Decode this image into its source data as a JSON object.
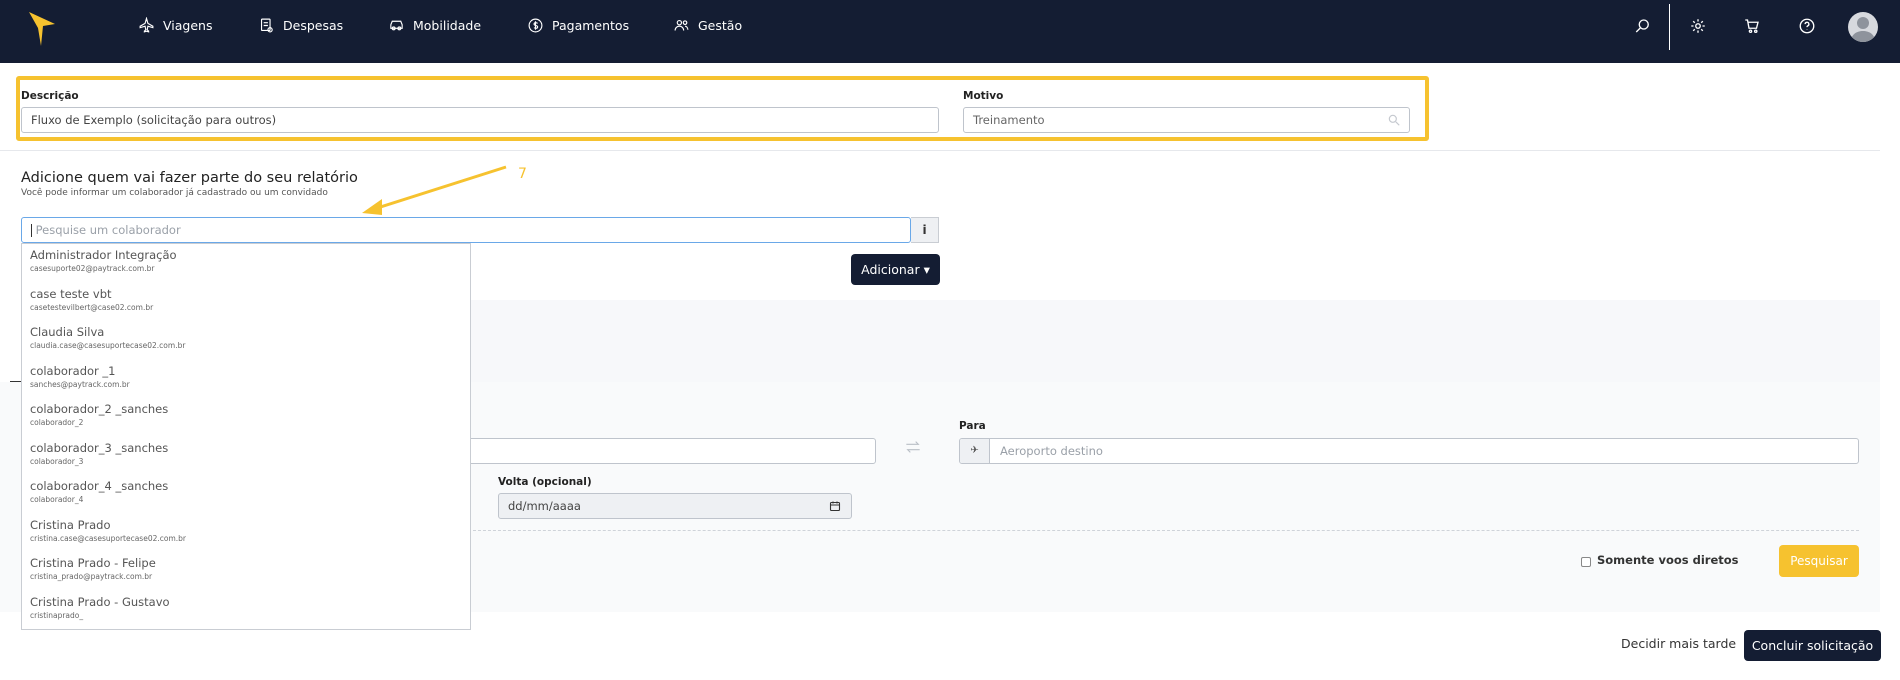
{
  "nav": {
    "items": [
      {
        "label": "Viagens",
        "icon": "plane-icon"
      },
      {
        "label": "Despesas",
        "icon": "receipt-icon"
      },
      {
        "label": "Mobilidade",
        "icon": "car-icon"
      },
      {
        "label": "Pagamentos",
        "icon": "dollar-circle-icon"
      },
      {
        "label": "Gestão",
        "icon": "users-icon"
      }
    ]
  },
  "form": {
    "descricao_label": "Descrição",
    "descricao_value": "Fluxo de Exemplo (solicitação para outros)",
    "motivo_label": "Motivo",
    "motivo_value": "Treinamento"
  },
  "participants": {
    "title": "Adicione quem vai fazer parte do seu relatório",
    "subtitle": "Você pode informar um colaborador já cadastrado ou um convidado",
    "search_placeholder": "Pesquise um colaborador",
    "info_label": "i",
    "add_button": "Adicionar ▾"
  },
  "annotation": {
    "number": "7",
    "color": "#f6c22f"
  },
  "dropdown": {
    "items": [
      {
        "name": "Administrador Integração",
        "email": "casesuporte02@paytrack.com.br"
      },
      {
        "name": "case teste vbt",
        "email": "casetestevilbert@case02.com.br"
      },
      {
        "name": "Claudia Silva",
        "email": "claudia.case@casesuportecase02.com.br"
      },
      {
        "name": "colaborador _1",
        "email": "sanches@paytrack.com.br"
      },
      {
        "name": "colaborador_2 _sanches",
        "email": "colaborador_2"
      },
      {
        "name": "colaborador_3 _sanches",
        "email": "colaborador_3"
      },
      {
        "name": "colaborador_4 _sanches",
        "email": "colaborador_4"
      },
      {
        "name": "Cristina Prado",
        "email": "cristina.case@casesuportecase02.com.br"
      },
      {
        "name": "Cristina Prado - Felipe",
        "email": "cristina_prado@paytrack.com.br"
      },
      {
        "name": "Cristina Prado - Gustavo",
        "email": "cristinaprado_"
      }
    ]
  },
  "flight": {
    "para_label": "Para",
    "para_placeholder": "Aeroporto destino",
    "volta_label": "Volta (opcional)",
    "volta_value": "dd/mm/aaaa",
    "direct_only_label": "Somente voos diretos",
    "search_button": "Pesquisar"
  },
  "footer": {
    "later_link": "Decidir mais tarde",
    "submit_button": "Concluir solicitação"
  },
  "colors": {
    "navbar": "#141d33",
    "accent": "#f6c22f"
  }
}
